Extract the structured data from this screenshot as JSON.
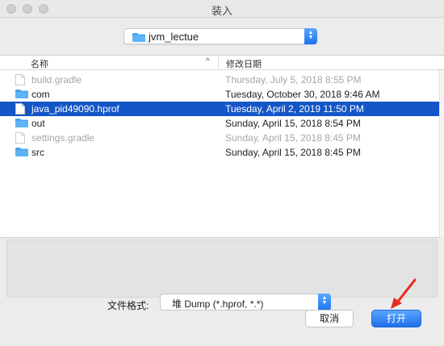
{
  "window": {
    "title": "装入"
  },
  "location": {
    "folder_name": "jvm_lectue"
  },
  "columns": {
    "name": "名称",
    "date": "修改日期"
  },
  "files": [
    {
      "name": "build.gradle",
      "date": "Thursday, July 5, 2018 8:55 PM",
      "kind": "file",
      "state": "disabled"
    },
    {
      "name": "com",
      "date": "Tuesday, October 30, 2018 9:46 AM",
      "kind": "folder",
      "state": "normal"
    },
    {
      "name": "java_pid49090.hprof",
      "date": "Tuesday, April 2, 2019 11:50 PM",
      "kind": "file",
      "state": "selected"
    },
    {
      "name": "out",
      "date": "Sunday, April 15, 2018 8:54 PM",
      "kind": "folder",
      "state": "normal"
    },
    {
      "name": "settings.gradle",
      "date": "Sunday, April 15, 2018 8:45 PM",
      "kind": "file",
      "state": "disabled"
    },
    {
      "name": "src",
      "date": "Sunday, April 15, 2018 8:45 PM",
      "kind": "folder",
      "state": "normal"
    }
  ],
  "format": {
    "label": "文件格式:",
    "selected": "堆 Dump (*.hprof, *.*)"
  },
  "buttons": {
    "cancel": "取消",
    "open": "打开"
  },
  "icons": {
    "folder": "folder-icon",
    "file": "file-icon",
    "sort": "sort-ascending-icon",
    "popup": "popup-stepper-icon",
    "annotation": "red-arrow-annotation"
  },
  "colors": {
    "accent": "#1f74ee",
    "selection": "#1456c8",
    "annotation": "#e8281e"
  }
}
